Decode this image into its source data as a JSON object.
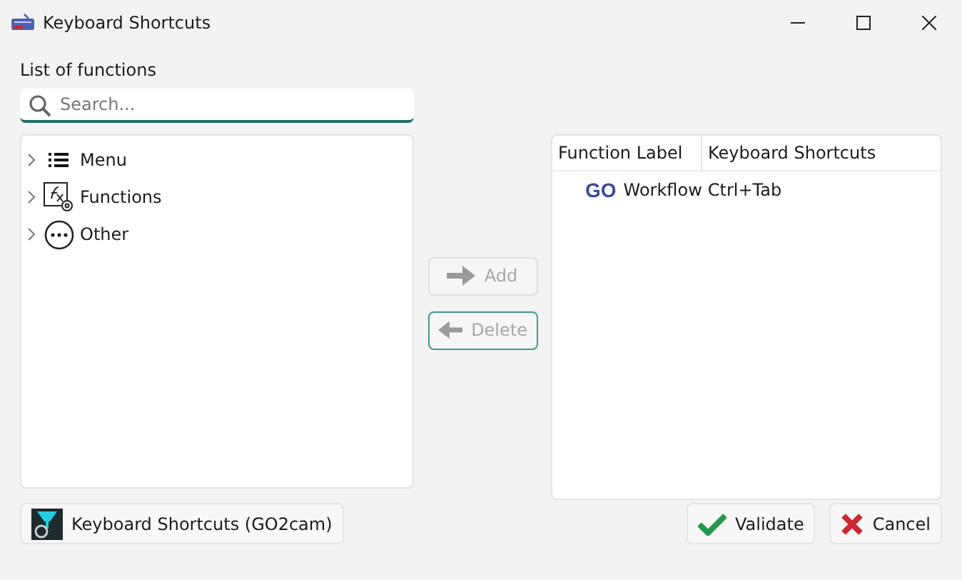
{
  "window": {
    "title": "Keyboard Shortcuts"
  },
  "functions_label": "List of functions",
  "search": {
    "placeholder": "Search..."
  },
  "tree": [
    {
      "kind": "menu",
      "label": "Menu",
      "expanded": false
    },
    {
      "kind": "functions",
      "label": "Functions",
      "expanded": false
    },
    {
      "kind": "other",
      "label": "Other",
      "expanded": false
    }
  ],
  "middle_buttons": [
    {
      "kind": "add",
      "label": "Add",
      "disabled": true,
      "focused": false
    },
    {
      "kind": "delete",
      "label": "Delete",
      "disabled": true,
      "focused": true
    }
  ],
  "table": {
    "columns": [
      "Function Label",
      "Keyboard Shortcuts"
    ],
    "rows": [
      {
        "logo": "GO",
        "label": "Workflow",
        "shortcut": "Ctrl+Tab"
      }
    ]
  },
  "footer": {
    "info_button": "Keyboard Shortcuts (GO2cam)",
    "buttons": [
      {
        "kind": "validate",
        "label": "Validate"
      },
      {
        "kind": "cancel",
        "label": "Cancel"
      }
    ]
  }
}
